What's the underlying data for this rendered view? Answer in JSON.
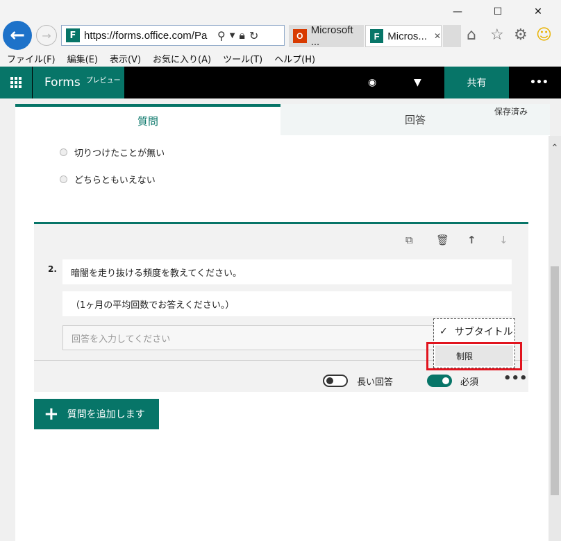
{
  "window": {
    "minimize": "—",
    "maximize": "☐",
    "close": "✕"
  },
  "browser": {
    "url": "https://forms.office.com/Pa",
    "tabs": [
      {
        "label": "Microsoft ...",
        "icon": "office-icon"
      },
      {
        "label": "Micros...",
        "icon": "forms-icon",
        "close": "✕"
      }
    ]
  },
  "menubar": {
    "items": [
      "ファイル(F)",
      "編集(E)",
      "表示(V)",
      "お気に入り(A)",
      "ツール(T)",
      "ヘルプ(H)"
    ]
  },
  "app": {
    "name": "Forms",
    "preview": "プレビュー",
    "share": "共有",
    "more": "•••"
  },
  "tabs": {
    "questions": "質問",
    "responses": "回答",
    "saved": "保存済み"
  },
  "previous_options": [
    "切りつけたことが無い",
    "どちらともいえない"
  ],
  "question": {
    "number": "2.",
    "title": "暗闇を走り抜ける頻度を教えてください。",
    "subtitle": "（1ヶ月の平均回数でお答えください。）",
    "answer_placeholder": "回答を入力してください",
    "long_answer_label": "長い回答",
    "long_answer_on": false,
    "required_label": "必須",
    "required_on": true,
    "more": "•••"
  },
  "menu": {
    "subtitle_label": "サブタイトル",
    "subtitle_checked": true,
    "restrict_label": "制限"
  },
  "add_question_label": "質問を追加します",
  "colors": {
    "accent": "#077568",
    "highlight": "#e1141e"
  }
}
